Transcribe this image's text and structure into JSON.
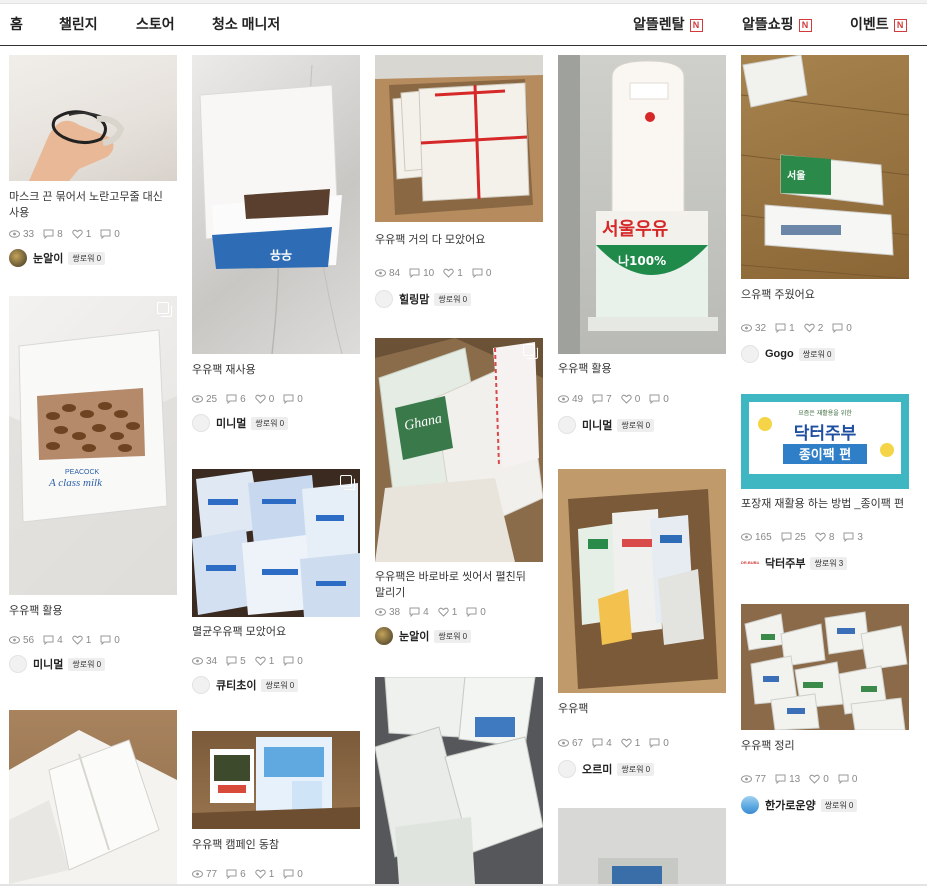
{
  "nav": {
    "left": [
      "홈",
      "챌린지",
      "스토어",
      "청소 매니저"
    ],
    "right": [
      {
        "label": "알뜰렌탈",
        "badge": "N"
      },
      {
        "label": "알뜰쇼핑",
        "badge": "N"
      },
      {
        "label": "이벤트",
        "badge": "N"
      }
    ]
  },
  "posts": [
    {
      "title": "마스크 끈 묶어서 노란고무줄 대신 사용",
      "views": "33",
      "comments": "8",
      "likes": "1",
      "scraps": "0",
      "author": "눈알이",
      "badge": "쌍로워 0"
    },
    {
      "title": "우유팩 활용",
      "views": "56",
      "comments": "4",
      "likes": "1",
      "scraps": "0",
      "author": "미니멀",
      "badge": "쌍로워 0"
    },
    {
      "title": "우유팩 재사용",
      "views": "25",
      "comments": "6",
      "likes": "0",
      "scraps": "0",
      "author": "미니멀",
      "badge": "쌍로워 0"
    },
    {
      "title": "멸균우유팩 모았어요",
      "views": "34",
      "comments": "5",
      "likes": "1",
      "scraps": "0",
      "author": "큐티초이",
      "badge": "쌍로워 0"
    },
    {
      "title": "우유팩 캠페인 동참",
      "views": "77",
      "comments": "6",
      "likes": "1",
      "scraps": "0"
    },
    {
      "title": "우유팩 거의 다 모았어요",
      "views": "84",
      "comments": "10",
      "likes": "1",
      "scraps": "0",
      "author": "힐링맘",
      "badge": "쌍로워 0"
    },
    {
      "title": "우유팩은 바로바로 씻어서 펼친뒤 말리기",
      "views": "38",
      "comments": "4",
      "likes": "1",
      "scraps": "0",
      "author": "눈알이",
      "badge": "쌍로워 0"
    },
    {
      "title": "우유팩 활용",
      "views": "49",
      "comments": "7",
      "likes": "0",
      "scraps": "0",
      "author": "미니멀",
      "badge": "쌍로워 0"
    },
    {
      "title": "우유팩",
      "views": "67",
      "comments": "4",
      "likes": "1",
      "scraps": "0",
      "author": "오르미",
      "badge": "쌍로워 0"
    },
    {
      "title": "으유팩 주웠어요",
      "views": "32",
      "comments": "1",
      "likes": "2",
      "scraps": "0",
      "author": "Gogo",
      "badge": "쌍로워 0"
    },
    {
      "title": "포장재 재활용 하는 방법 _종이팩 편",
      "views": "165",
      "comments": "25",
      "likes": "8",
      "scraps": "3",
      "author": "닥터주부",
      "badge": "쌍로워 3",
      "avatar_text": "DR.BUBU"
    },
    {
      "title": "우유팩 정리",
      "views": "77",
      "comments": "13",
      "likes": "0",
      "scraps": "0",
      "author": "한가로운양",
      "badge": "쌍로워 0"
    }
  ],
  "image_text": {
    "doctor_line": "요즘은 재활용을 위한",
    "doctor_title_1": "닥터주부",
    "doctor_title_2": "종이팩 편",
    "seoul_milk": "서울우유",
    "percent": "나100%",
    "seoul_small": "서울우유",
    "ghana": "Ghana",
    "peacock": "PEACOCK",
    "aclass": "A class milk"
  },
  "colors": {
    "accent": "#d23b3b",
    "nav_border": "#333333",
    "meta": "#888888"
  }
}
